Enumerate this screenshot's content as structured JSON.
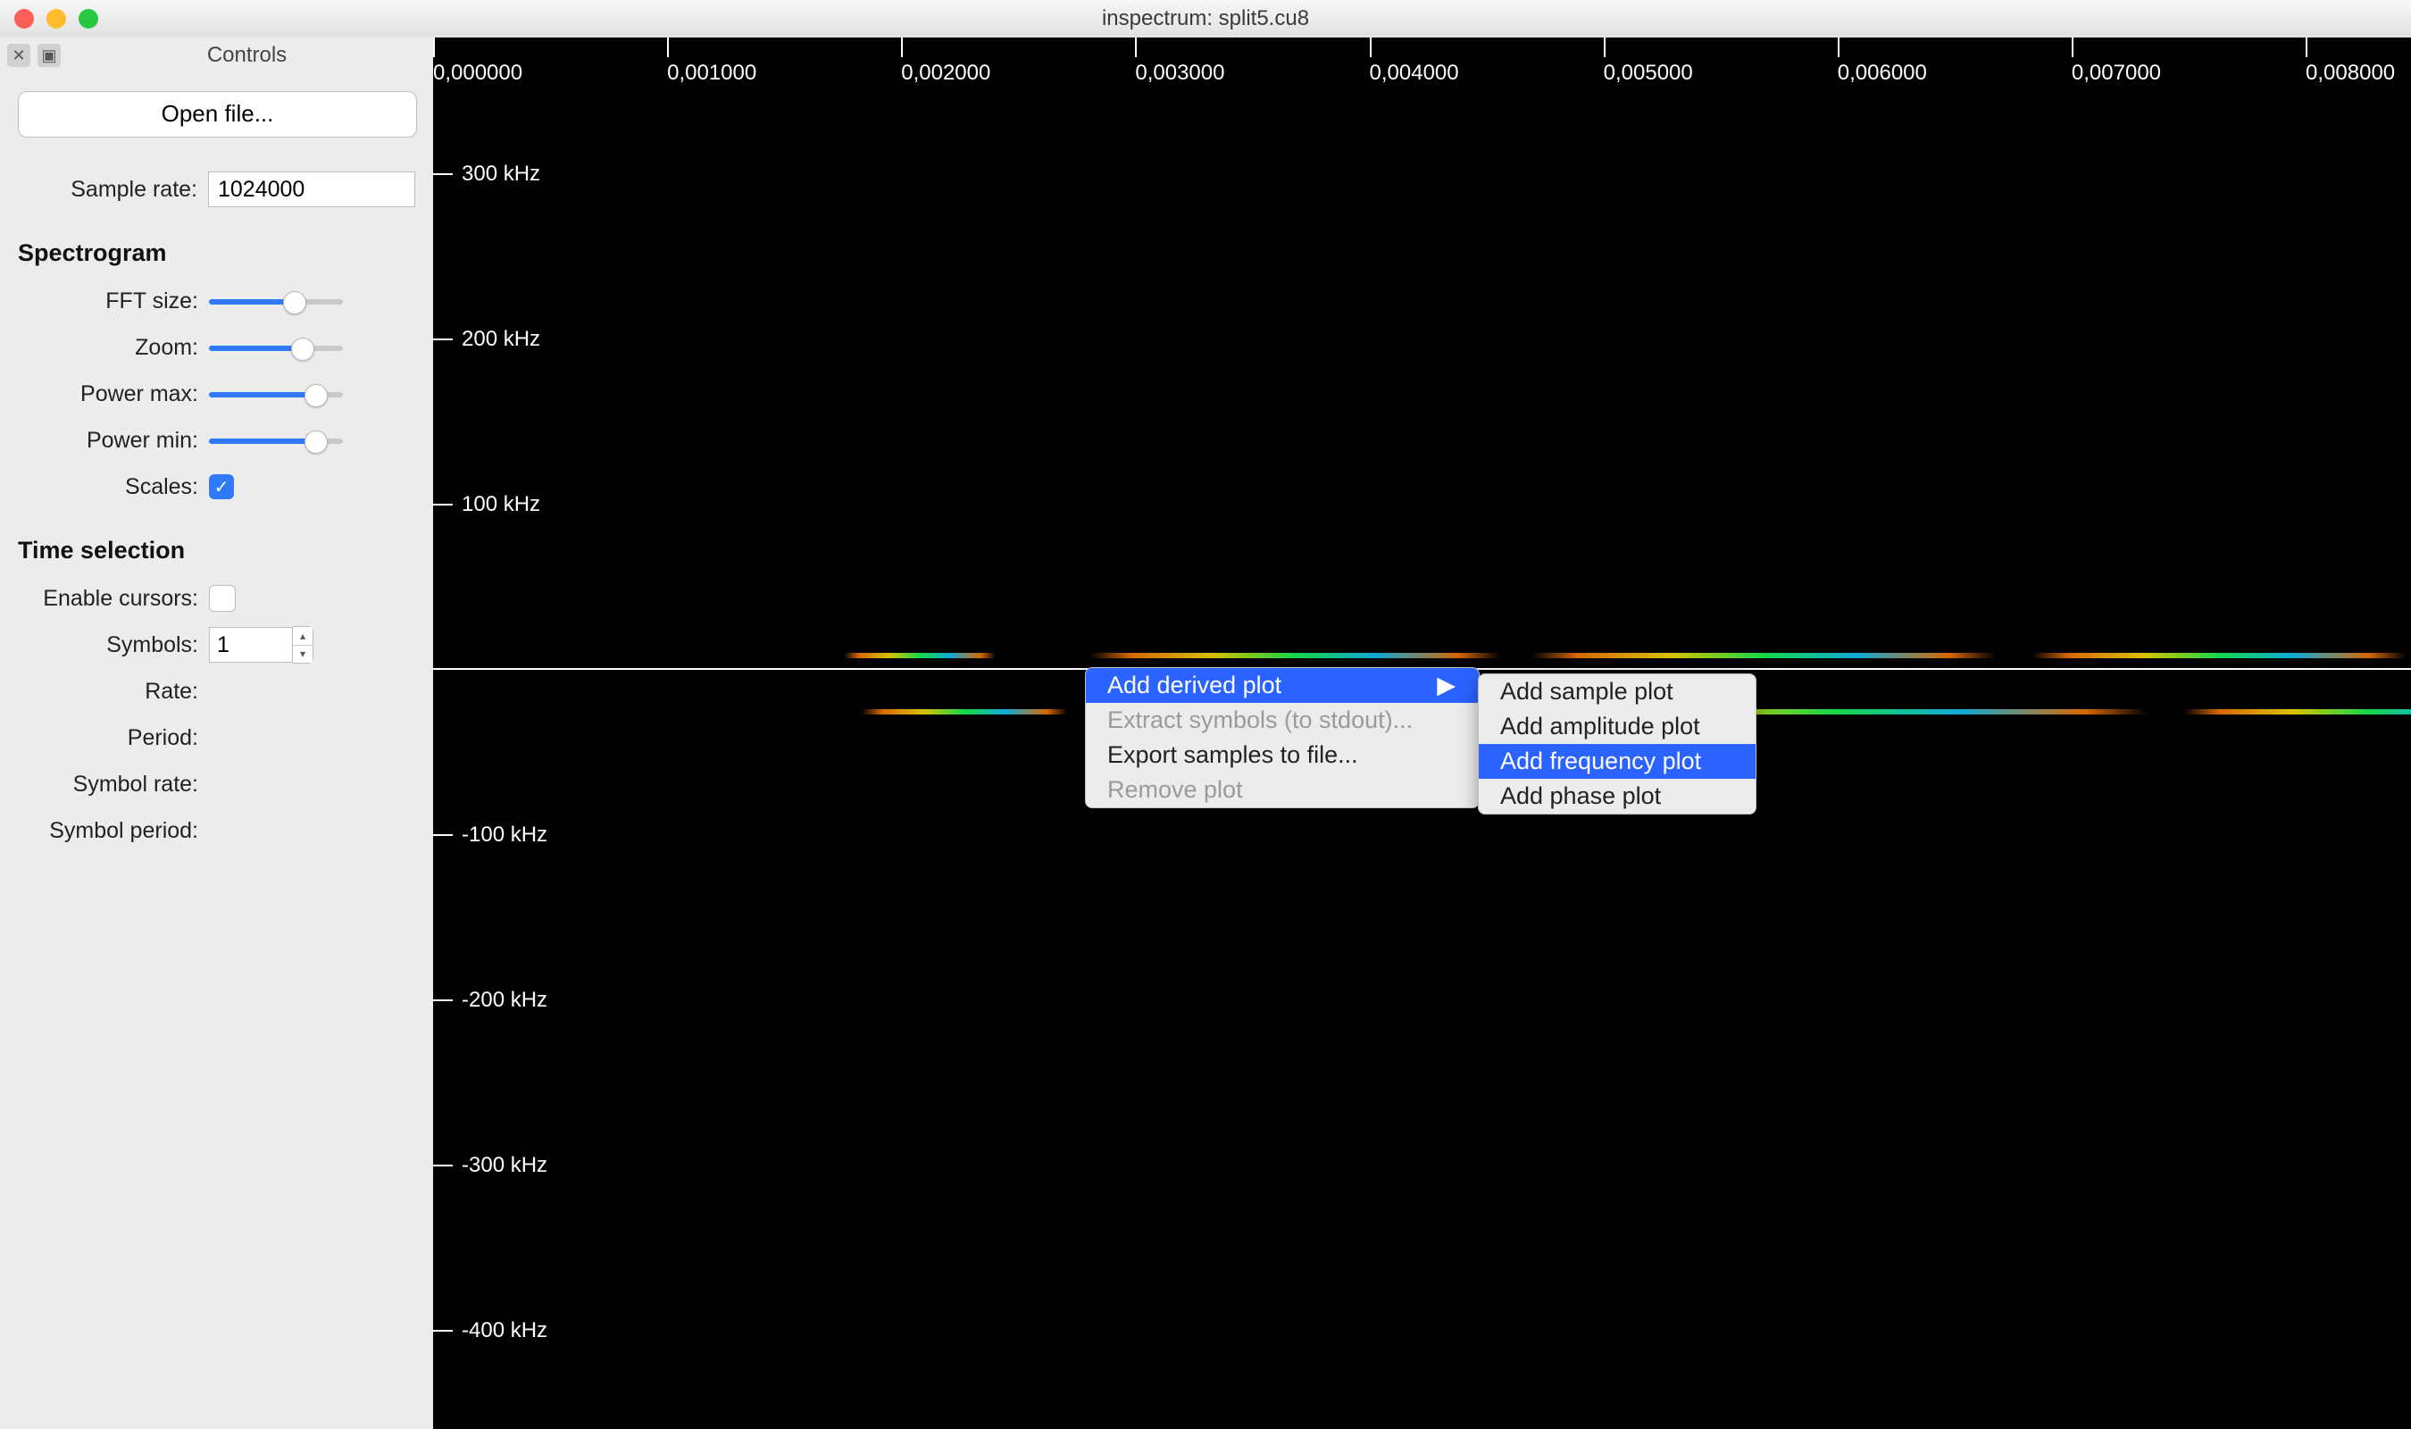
{
  "window": {
    "title": "inspectrum: split5.cu8"
  },
  "dock": {
    "title": "Controls"
  },
  "sidebar": {
    "open_file": "Open file...",
    "sample_rate": {
      "label": "Sample rate:",
      "value": "1024000"
    },
    "spectrogram": {
      "heading": "Spectrogram",
      "fft": {
        "label": "FFT size:",
        "pos": 0.64
      },
      "zoom": {
        "label": "Zoom:",
        "pos": 0.7
      },
      "powermax": {
        "label": "Power max:",
        "pos": 0.8
      },
      "powermin": {
        "label": "Power min:",
        "pos": 0.8
      },
      "scales": {
        "label": "Scales:",
        "checked": true
      }
    },
    "time": {
      "heading": "Time selection",
      "enable": {
        "label": "Enable cursors:"
      },
      "symbols": {
        "label": "Symbols:",
        "value": "1"
      },
      "rate": "Rate:",
      "period": "Period:",
      "symbol_rate": "Symbol rate:",
      "symbol_period": "Symbol period:"
    }
  },
  "time_axis": [
    "0,000000",
    "0,001000",
    "0,002000",
    "0,003000",
    "0,004000",
    "0,005000",
    "0,006000",
    "0,007000",
    "0,008000"
  ],
  "freq_axis": [
    "300 kHz",
    "200 kHz",
    "100 kHz",
    "-100 kHz",
    "-200 kHz",
    "-300 kHz",
    "-400 kHz"
  ],
  "menu1": {
    "items": [
      {
        "label": "Add derived plot",
        "state": "hl",
        "submenu": true
      },
      {
        "label": "Extract symbols (to stdout)...",
        "state": "dis"
      },
      {
        "label": "Export samples to file..."
      },
      {
        "label": "Remove plot",
        "state": "dis"
      }
    ]
  },
  "menu2": {
    "items": [
      {
        "label": "Add sample plot"
      },
      {
        "label": "Add amplitude plot"
      },
      {
        "label": "Add frequency plot",
        "state": "hl"
      },
      {
        "label": "Add phase plot"
      }
    ]
  },
  "glyph": {
    "check": "✓",
    "up": "▴",
    "down": "▾",
    "right": "▶"
  }
}
